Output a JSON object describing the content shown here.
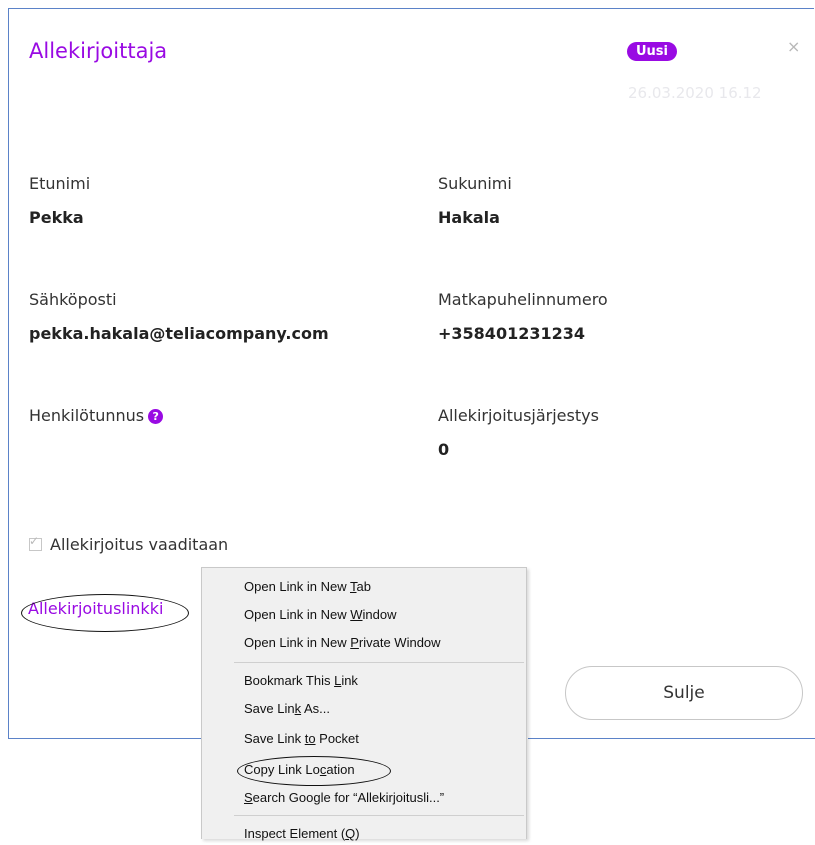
{
  "dialog": {
    "title": "Allekirjoittaja",
    "status_badge": "Uusi",
    "date": "26.03.2020 16.12",
    "close_glyph": "×"
  },
  "fields": {
    "first_name": {
      "label": "Etunimi",
      "value": "Pekka"
    },
    "last_name": {
      "label": "Sukunimi",
      "value": "Hakala"
    },
    "email": {
      "label": "Sähköposti",
      "value": "pekka.hakala@teliacompany.com"
    },
    "mobile": {
      "label": "Matkapuhelinnumero",
      "value": "+358401231234"
    },
    "ssn": {
      "label": "Henkilötunnus",
      "help_icon": "question-circle-icon",
      "help_glyph": "?"
    },
    "order": {
      "label": "Allekirjoitusjärjestys",
      "value": "0"
    }
  },
  "signature_required": {
    "label": "Allekirjoitus vaaditaan",
    "checked": true,
    "tick": "✓"
  },
  "signing_link": {
    "label": "Allekirjoituslinkki"
  },
  "close_button": {
    "label": "Sulje"
  },
  "context_menu": {
    "items": [
      {
        "pre": "Open Link in New ",
        "ul": "T",
        "post": "ab"
      },
      {
        "pre": "Open Link in New ",
        "ul": "W",
        "post": "indow"
      },
      {
        "pre": "Open Link in New ",
        "ul": "P",
        "post": "rivate Window"
      },
      {
        "pre": "Bookmark This ",
        "ul": "L",
        "post": "ink"
      },
      {
        "pre": "Save Lin",
        "ul": "k",
        "post": " As..."
      },
      {
        "pre": "Save Link ",
        "ul": "to",
        "post": " Pocket"
      },
      {
        "pre": "Copy Link Lo",
        "ul": "c",
        "post": "ation"
      },
      {
        "pre": "",
        "ul": "S",
        "post": "earch Google for “Allekirjoitusli...”"
      },
      {
        "pre": "Inspect Element (",
        "ul": "Q",
        "post": ")"
      }
    ]
  },
  "colors": {
    "accent": "#990ae3",
    "border": "#5b82c8",
    "menu_bg": "#f0f0f0"
  }
}
